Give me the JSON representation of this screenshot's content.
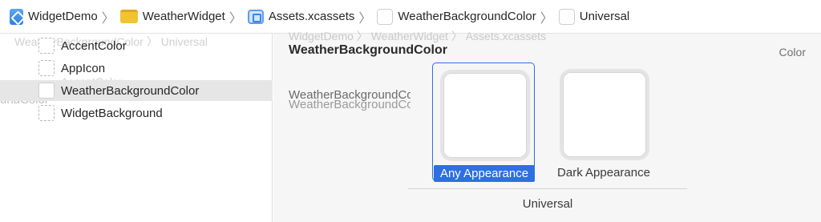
{
  "breadcrumb": {
    "items": [
      {
        "label": "WidgetDemo",
        "icon": "project-icon"
      },
      {
        "label": "WeatherWidget",
        "icon": "folder-icon"
      },
      {
        "label": "Assets.xcassets",
        "icon": "asset-catalog-icon"
      },
      {
        "label": "WeatherBackgroundColor",
        "icon": "color-set-icon"
      },
      {
        "label": "Universal",
        "icon": "color-set-icon"
      }
    ],
    "separator": "〉"
  },
  "asset_list": {
    "items": [
      {
        "label": "AccentColor"
      },
      {
        "label": "AppIcon"
      },
      {
        "label": "WeatherBackgroundColor",
        "selected": true
      },
      {
        "label": "WidgetBackground"
      }
    ]
  },
  "ghost_text": {
    "line1": "WeatherBackgroundColor 〉 Universal",
    "line2": "AccentColor",
    "line3": "undColor",
    "line4": "WidgetDemo 〉 WeatherWidget 〉 Assets.xcassets"
  },
  "editor": {
    "title": "WeatherBackgroundColor",
    "type_label": "Color",
    "side_label": "WeatherBackgroundColor",
    "side_ghost": "WeatherBackgroundColor",
    "slots": [
      {
        "label": "Any Appearance",
        "selected": true
      },
      {
        "label": "Dark Appearance",
        "selected": false
      }
    ],
    "group_label": "Universal"
  },
  "colors": {
    "accent": "#2f6fe0",
    "selection_row": "#e6e6e6"
  }
}
